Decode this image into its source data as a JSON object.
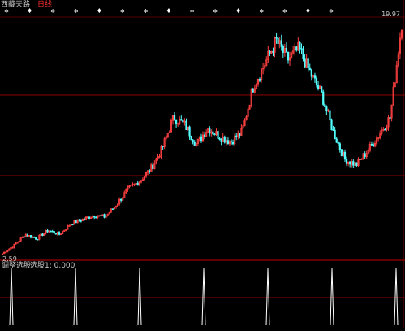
{
  "header": {
    "title": "西藏天路",
    "period": "日线"
  },
  "price_axis": {
    "max_label": "19.97",
    "min_label": "2.59"
  },
  "indicator": {
    "name": "调整选股",
    "selection_label": "选股1: 0.000"
  },
  "colors": {
    "background": "#000000",
    "up_candle": "#ff4040",
    "down_candle": "#54ffff",
    "grid_line": "#8b0000",
    "signal_marker": "#ffffff"
  },
  "chart_data": {
    "type": "candlestick",
    "series_close": [
      2.6,
      3.2,
      4.0,
      3.7,
      4.3,
      4.0,
      4.8,
      5.1,
      5.4,
      5.3,
      6.2,
      7.3,
      7.9,
      8.8,
      10.3,
      12.6,
      12.0,
      10.6,
      11.8,
      11.2,
      10.8,
      11.5,
      14.9,
      16.5,
      18.2,
      16.8,
      17.6,
      15.8,
      14.2,
      11.5,
      9.5,
      9.1,
      10.1,
      11.3,
      12.6,
      19.5
    ],
    "ylim": [
      2.59,
      19.97
    ],
    "signals": {
      "top_marker_count": 15,
      "indicator_spike_count": 7
    }
  }
}
